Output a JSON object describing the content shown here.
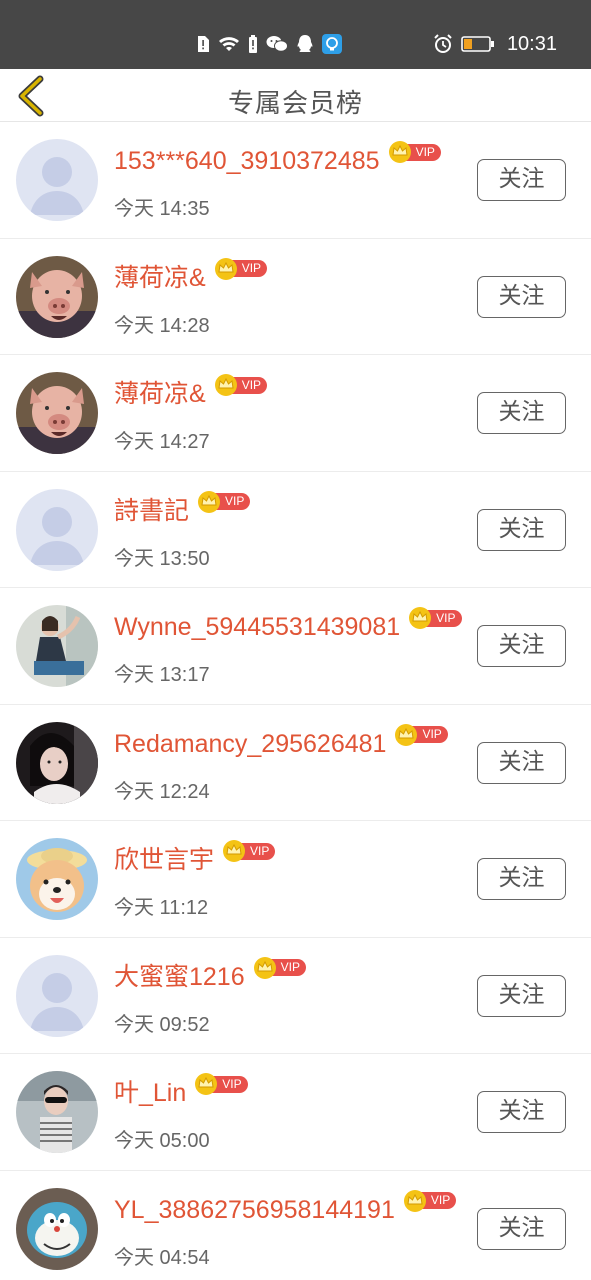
{
  "status_bar": {
    "time": "10:31",
    "icons": [
      "sim-alert-icon",
      "wifi-icon",
      "battery-small-icon",
      "wechat-icon",
      "qq-icon",
      "app-icon",
      "alarm-icon",
      "battery-icon"
    ]
  },
  "header": {
    "title": "专属会员榜",
    "back_icon": "chevron-left-icon"
  },
  "badge": {
    "vip_label": "VIP"
  },
  "colors": {
    "name": "#e05536",
    "vip": "#e8504b",
    "status_bar": "#474747",
    "back": "#c7a300"
  },
  "users": [
    {
      "name": "153***640_3910372485",
      "time": "今天 14:35",
      "follow": "关注",
      "avatar": "default"
    },
    {
      "name": "薄荷凉&",
      "time": "今天 14:28",
      "follow": "关注",
      "avatar": "pig"
    },
    {
      "name": "薄荷凉&",
      "time": "今天 14:27",
      "follow": "关注",
      "avatar": "pig"
    },
    {
      "name": "詩書記",
      "time": "今天 13:50",
      "follow": "关注",
      "avatar": "default"
    },
    {
      "name": "Wynne_59445531439081",
      "time": "今天 13:17",
      "follow": "关注",
      "avatar": "woman-sitting"
    },
    {
      "name": "Redamancy_295626481",
      "time": "今天 12:24",
      "follow": "关注",
      "avatar": "woman-dark"
    },
    {
      "name": "欣世言宇",
      "time": "今天 11:12",
      "follow": "关注",
      "avatar": "shiba-dog"
    },
    {
      "name": "大蜜蜜1216",
      "time": "今天 09:52",
      "follow": "关注",
      "avatar": "default"
    },
    {
      "name": "叶_Lin",
      "time": "今天 05:00",
      "follow": "关注",
      "avatar": "woman-sunglasses"
    },
    {
      "name": "YL_38862756958144191",
      "time": "今天 04:54",
      "follow": "关注",
      "avatar": "doraemon-plush"
    }
  ]
}
